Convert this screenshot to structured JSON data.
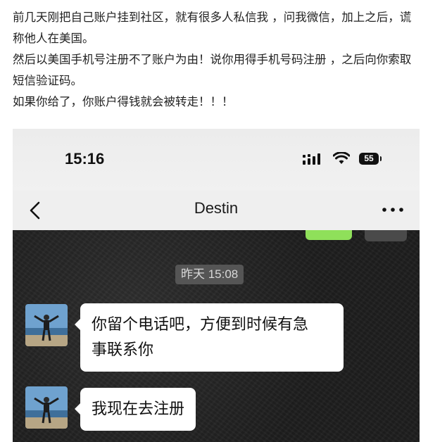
{
  "article": {
    "paragraphs": [
      "前几天刚把自己账户挂到社区，就有很多人私信我 ，问我微信，加上之后，谎称他人在美国。",
      "然后以美国手机号注册不了账户为由！说你用得手机号码注册 ，之后向你索取短信验证码。",
      "如果你给了，你账户得钱就会被转走！！！"
    ]
  },
  "phone": {
    "status_time": "15:16",
    "battery_level": "55",
    "chat_title": "Destin",
    "timestamp": "昨天 15:08",
    "messages": [
      {
        "text_line1": "你留个电话吧，方便到时候有急",
        "text_line2": "事联系你"
      },
      {
        "text_line1": "我现在去注册"
      }
    ]
  },
  "icons": {
    "back": "chevron-left-icon",
    "more": "more-dots-icon",
    "signal": "cellular-signal-icon",
    "wifi": "wifi-icon",
    "battery": "battery-icon"
  }
}
